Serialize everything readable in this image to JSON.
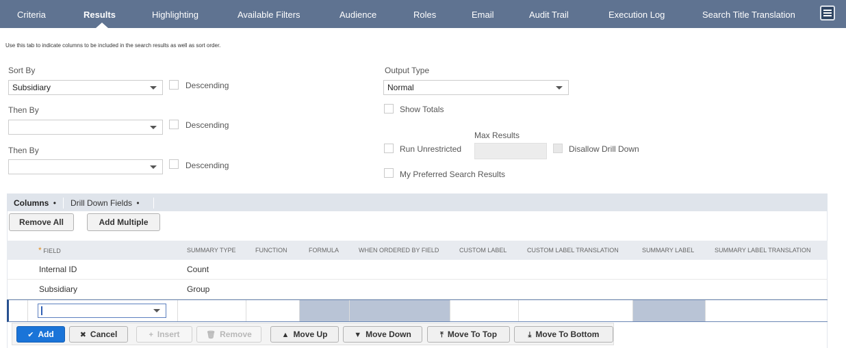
{
  "tabs": [
    {
      "label": "Criteria",
      "active": false
    },
    {
      "label": "Results",
      "active": true
    },
    {
      "label": "Highlighting",
      "active": false
    },
    {
      "label": "Available Filters",
      "active": false
    },
    {
      "label": "Audience",
      "active": false
    },
    {
      "label": "Roles",
      "active": false
    },
    {
      "label": "Email",
      "active": false
    },
    {
      "label": "Audit Trail",
      "active": false
    },
    {
      "label": "Execution Log",
      "active": false
    },
    {
      "label": "Search Title Translation",
      "active": false
    }
  ],
  "hint": "Use this tab to indicate columns to be included in the search results as well as sort order.",
  "sort": {
    "sort_by_label": "Sort By",
    "sort_by_value": "Subsidiary",
    "then_by_label_1": "Then By",
    "then_by_value_1": "",
    "then_by_label_2": "Then By",
    "then_by_value_2": "",
    "descending_label": "Descending"
  },
  "output": {
    "output_type_label": "Output Type",
    "output_type_value": "Normal",
    "show_totals_label": "Show Totals",
    "max_results_label": "Max Results",
    "max_results_value": "",
    "run_unrestricted_label": "Run Unrestricted",
    "disallow_drill_down_label": "Disallow Drill Down",
    "preferred_label": "My Preferred Search Results"
  },
  "subtabs": {
    "columns": "Columns",
    "drill_down": "Drill Down Fields",
    "bullet": "•"
  },
  "actions": {
    "remove_all": "Remove All",
    "add_multiple": "Add Multiple"
  },
  "table": {
    "required_mark": "*",
    "headers": [
      "Field",
      "Summary Type",
      "Function",
      "Formula",
      "When Ordered By Field",
      "Custom Label",
      "Custom Label Translation",
      "Summary Label",
      "Summary Label Translation"
    ],
    "rows": [
      {
        "field": "Internal ID",
        "summary_type": "Count"
      },
      {
        "field": "Subsidiary",
        "summary_type": "Group"
      }
    ]
  },
  "toolbar": {
    "add": "Add",
    "cancel": "Cancel",
    "insert": "Insert",
    "remove": "Remove",
    "move_up": "Move Up",
    "move_down": "Move Down",
    "move_to_top": "Move To Top",
    "move_to_bottom": "Move To Bottom"
  },
  "colors": {
    "tab_bar": "#5f7391",
    "primary": "#1a74d8",
    "subtab_bg": "#dfe4eb",
    "header_bg": "#e8ebf0",
    "shaded_cell": "#b9c4d6"
  }
}
